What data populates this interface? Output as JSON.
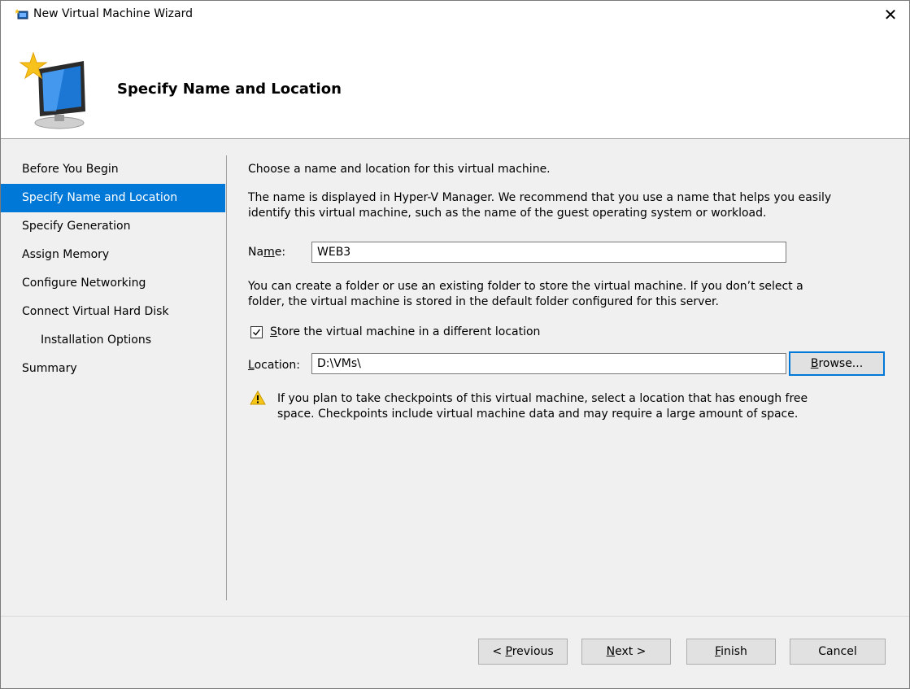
{
  "window": {
    "title": "New Virtual Machine Wizard",
    "close_label": "✕"
  },
  "banner": {
    "title": "Specify Name and Location"
  },
  "sidebar": {
    "items": [
      {
        "label": "Before You Begin"
      },
      {
        "label": "Specify Name and Location",
        "active": true
      },
      {
        "label": "Specify Generation"
      },
      {
        "label": "Assign Memory"
      },
      {
        "label": "Configure Networking"
      },
      {
        "label": "Connect Virtual Hard Disk"
      },
      {
        "label": "Installation Options"
      },
      {
        "label": "Summary"
      }
    ]
  },
  "main": {
    "intro": "Choose a name and location for this virtual machine.",
    "desc_line1": "The name is displayed in Hyper-V Manager. We recommend that you use a name that helps you easily",
    "desc_line2": "identify this virtual machine, such as the name of the guest operating system or workload.",
    "name_label_pre": "Na",
    "name_label_key": "m",
    "name_label_post": "e:",
    "name_value": "WEB3",
    "folder_line1": "You can create a folder or use an existing folder to store the virtual machine. If you don’t select a",
    "folder_line2": "folder, the virtual machine is stored in the default folder configured for this server.",
    "store_checked": true,
    "store_label_key": "S",
    "store_label_rest": "tore the virtual machine in a different location",
    "location_label_key": "L",
    "location_label_rest": "ocation:",
    "location_value": "D:\\VMs\\",
    "browse_key": "B",
    "browse_rest": "rowse...",
    "warning_line1": "If you plan to take checkpoints of this virtual machine, select a location that has enough free",
    "warning_line2": "space. Checkpoints include virtual machine data and may require a large amount of space."
  },
  "footer": {
    "previous_pre": "< ",
    "previous_key": "P",
    "previous_rest": "revious",
    "next_key": "N",
    "next_rest": "ext >",
    "finish_key": "F",
    "finish_rest": "inish",
    "cancel_label": "Cancel"
  },
  "colors": {
    "accent": "#0078d7",
    "dialog_bg": "#f0f0f0",
    "warning": "#f5c518"
  }
}
